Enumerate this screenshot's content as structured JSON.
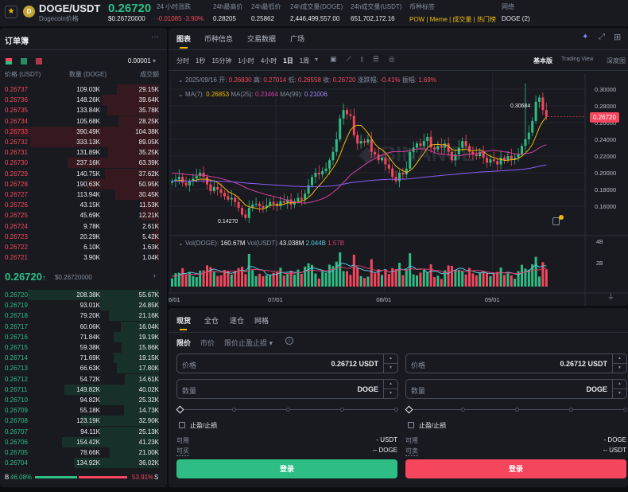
{
  "header": {
    "symbol": "DOGE/USDT",
    "subtitle": "Dogecoin价格",
    "price": "0.26720",
    "price_usd": "$0.26720000",
    "stats": [
      {
        "label": "24 小时涨跌",
        "value": "-0.01085 -3.90%"
      },
      {
        "label": "24h最高价",
        "value": "0.28205"
      },
      {
        "label": "24h最低价",
        "value": "0.25862"
      },
      {
        "label": "24h成交量(DOGE)",
        "value": "2,446,499,557.00"
      },
      {
        "label": "24h成交量(USDT)",
        "value": "651,702,172.16"
      }
    ],
    "tags_label": "币种标签",
    "tags": [
      "POW",
      "Meme",
      "成交量",
      "热门榜"
    ],
    "network_label": "网络",
    "network_value": "DOGE (2)"
  },
  "orderbook": {
    "title": "订单簿",
    "precision": "0.00001",
    "col_price": "价格 (USDT)",
    "col_qty": "数量 (DOGE)",
    "col_total": "成交额",
    "asks": [
      [
        "0.26737",
        "109.03K",
        "29.15K"
      ],
      [
        "0.26736",
        "148.26K",
        "39.64K"
      ],
      [
        "0.26735",
        "133.84K",
        "35.78K"
      ],
      [
        "0.26734",
        "105.68K",
        "28.25K"
      ],
      [
        "0.26733",
        "390.49K",
        "104.38K"
      ],
      [
        "0.26732",
        "333.13K",
        "89.05K"
      ],
      [
        "0.26731",
        "131.89K",
        "35.25K"
      ],
      [
        "0.26730",
        "237.16K",
        "63.39K"
      ],
      [
        "0.26729",
        "140.75K",
        "37.62K"
      ],
      [
        "0.26728",
        "190.63K",
        "50.95K"
      ],
      [
        "0.26727",
        "113.94K",
        "30.45K"
      ],
      [
        "0.26726",
        "43.15K",
        "11.53K"
      ],
      [
        "0.26725",
        "45.69K",
        "12.21K"
      ],
      [
        "0.26724",
        "9.78K",
        "2.61K"
      ],
      [
        "0.26723",
        "20.29K",
        "5.42K"
      ],
      [
        "0.26722",
        "6.10K",
        "1.63K"
      ],
      [
        "0.26721",
        "3.90K",
        "1.04K"
      ]
    ],
    "mid_price": "0.26720",
    "mid_arrow": "↑",
    "mid_usd": "$0.26720000",
    "bids": [
      [
        "0.26720",
        "208.38K",
        "55.67K"
      ],
      [
        "0.26719",
        "93.01K",
        "24.85K"
      ],
      [
        "0.26718",
        "79.20K",
        "21.16K"
      ],
      [
        "0.26717",
        "60.06K",
        "16.04K"
      ],
      [
        "0.26716",
        "71.84K",
        "19.19K"
      ],
      [
        "0.26715",
        "59.38K",
        "15.86K"
      ],
      [
        "0.26714",
        "71.69K",
        "19.15K"
      ],
      [
        "0.26713",
        "66.63K",
        "17.80K"
      ],
      [
        "0.26712",
        "54.72K",
        "14.61K"
      ],
      [
        "0.26711",
        "149.82K",
        "40.02K"
      ],
      [
        "0.26710",
        "94.82K",
        "25.32K"
      ],
      [
        "0.26709",
        "55.18K",
        "14.73K"
      ],
      [
        "0.26708",
        "123.19K",
        "32.90K"
      ],
      [
        "0.26707",
        "94.11K",
        "25.13K"
      ],
      [
        "0.26706",
        "154.42K",
        "41.23K"
      ],
      [
        "0.26705",
        "78.66K",
        "21.00K"
      ],
      [
        "0.26704",
        "134.92K",
        "36.02K"
      ]
    ],
    "buy_label": "B",
    "buy_pct": "46.08%",
    "sell_pct": "53.91%",
    "sell_label": "S",
    "buy_ratio": 46.08
  },
  "chart": {
    "tabs": [
      "图表",
      "币种信息",
      "交易数据",
      "广场"
    ],
    "intervals": [
      "分时",
      "1秒",
      "15分钟",
      "1小时",
      "4小时",
      "1日",
      "1周"
    ],
    "active_interval": "1日",
    "views": [
      "基本版",
      "Trading View",
      "深度图"
    ],
    "ohlc": {
      "date": "2025/09/16",
      "open_label": "开:",
      "open": "0.26830",
      "high_label": "高:",
      "high": "0.27014",
      "low_label": "低:",
      "low": "0.26558",
      "close_label": "收:",
      "close": "0.26720",
      "chg_label": "涨跌幅:",
      "chg": "-0.41%",
      "amp_label": "振幅:",
      "amp": "1.69%"
    },
    "ma": {
      "ma7_label": "MA(7):",
      "ma7": "0.26853",
      "ma25_label": "MA(25):",
      "ma25": "0.23464",
      "ma99_label": "MA(99):",
      "ma99": "0.21006"
    },
    "vol": {
      "label1": "Vol(DOGE):",
      "v1": "160.67M",
      "label2": "Vol(USDT)",
      "v2": "43.038M",
      "v3": "2.044B",
      "v4": "1.57B"
    },
    "max_label": "0.30684",
    "min_label": "0.14270",
    "current_tag": "0.26720",
    "vol_ticks": [
      "4B",
      "2B"
    ],
    "colors": {
      "up": "#2ebd85",
      "down": "#f6465d",
      "ma7": "#f0b90b",
      "ma25": "#d63ea0",
      "ma99": "#8b5cf6"
    }
  },
  "chart_data": {
    "type": "candlestick",
    "start": "06/01",
    "price_ticks": [
      "0.30000",
      "0.28000",
      "0.26000",
      "0.24000",
      "0.22000",
      "0.20000",
      "0.18000",
      "0.16000"
    ],
    "date_ticks": [
      [
        "6/01",
        0
      ],
      [
        "07/01",
        30
      ],
      [
        "08/01",
        61
      ],
      [
        "09/01",
        92
      ]
    ],
    "closes": [
      0.19,
      0.192,
      0.195,
      0.188,
      0.185,
      0.19,
      0.193,
      0.196,
      0.2,
      0.195,
      0.186,
      0.178,
      0.183,
      0.18,
      0.176,
      0.172,
      0.168,
      0.17,
      0.165,
      0.158,
      0.15,
      0.146,
      0.158,
      0.162,
      0.163,
      0.16,
      0.158,
      0.161,
      0.165,
      0.163,
      0.16,
      0.166,
      0.164,
      0.168,
      0.162,
      0.166,
      0.17,
      0.168,
      0.175,
      0.185,
      0.195,
      0.2,
      0.198,
      0.202,
      0.205,
      0.215,
      0.225,
      0.24,
      0.265,
      0.275,
      0.27,
      0.268,
      0.245,
      0.235,
      0.238,
      0.236,
      0.24,
      0.225,
      0.222,
      0.215,
      0.218,
      0.21,
      0.205,
      0.195,
      0.19,
      0.2,
      0.198,
      0.205,
      0.225,
      0.23,
      0.235,
      0.232,
      0.238,
      0.243,
      0.23,
      0.228,
      0.232,
      0.23,
      0.235,
      0.225,
      0.215,
      0.222,
      0.23,
      0.238,
      0.232,
      0.225,
      0.222,
      0.22,
      0.225,
      0.218,
      0.212,
      0.216,
      0.214,
      0.21,
      0.218,
      0.215,
      0.22,
      0.216,
      0.218,
      0.222,
      0.232,
      0.24,
      0.248,
      0.262,
      0.285,
      0.29,
      0.275,
      0.2672
    ]
  },
  "form": {
    "tabs": [
      "现货",
      "全仓",
      "逐仓",
      "网格"
    ],
    "types": [
      "限价",
      "市价",
      "限价止盈止损 ▾"
    ],
    "buy": {
      "price_label": "价格",
      "price": "0.26712  USDT",
      "qty_label": "数量",
      "qty_unit": "DOGE",
      "tpsl": "止盈/止损",
      "avail_label": "可用",
      "avail": "- USDT",
      "max_label": "可买",
      "max": "-- DOGE",
      "button": "登录"
    },
    "sell": {
      "price_label": "价格",
      "price": "0.26712  USDT",
      "qty_label": "数量",
      "qty_unit": "DOGE",
      "tpsl": "止盈/止损",
      "avail_label": "可用",
      "avail": "- DOGE",
      "max_label": "可卖",
      "max": "-- USDT",
      "button": "登录"
    }
  }
}
